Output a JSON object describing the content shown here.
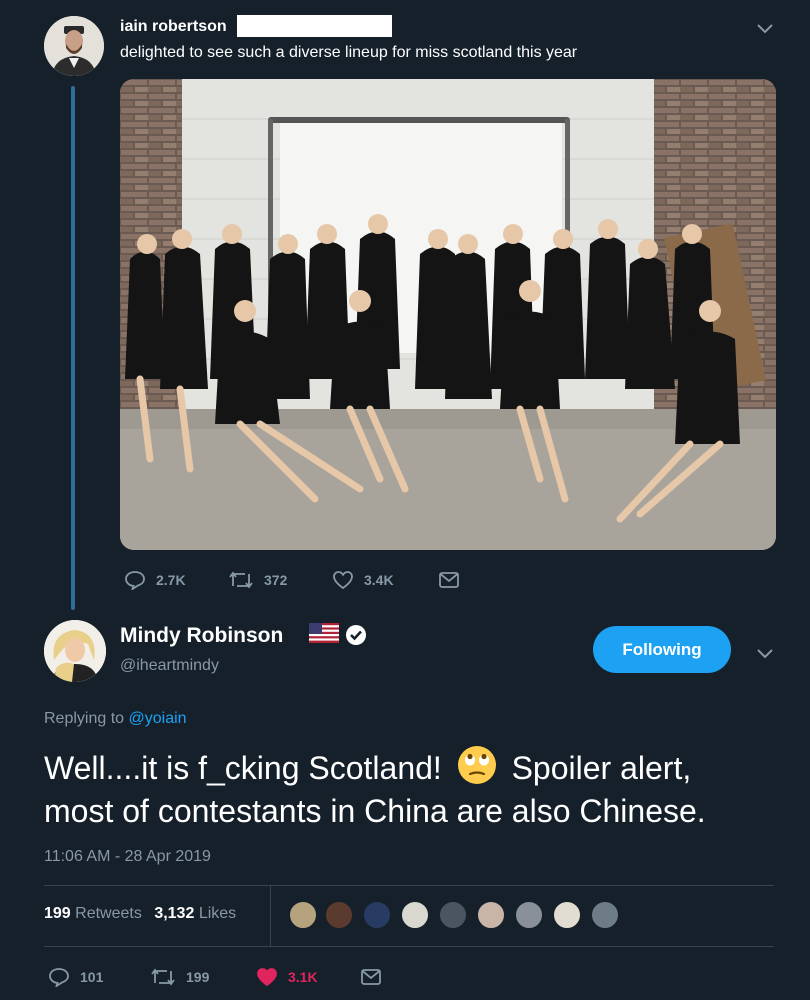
{
  "parent_tweet": {
    "author_name": "iain robertson",
    "text": "delighted to see such a diverse lineup for miss scotland this year",
    "counts": {
      "replies": "2.7K",
      "retweets": "372",
      "likes": "3.4K"
    }
  },
  "main_tweet": {
    "author_name": "Mindy Robinson",
    "handle": "@iheartmindy",
    "follow_label": "Following",
    "replying_prefix": "Replying to",
    "replying_handle": "@yoiain",
    "text_line1": "Well....it is f_cking Scotland!",
    "text_line1b": "Spoiler alert,",
    "text_line2": "most of contestants in China are also Chinese.",
    "timestamp": "11:06 AM - 28 Apr 2019",
    "stats": {
      "retweets_count": "199",
      "retweets_label": "Retweets",
      "likes_count": "3,132",
      "likes_label": "Likes"
    },
    "actions": {
      "replies": "101",
      "retweets": "199",
      "likes": "3.1K"
    }
  },
  "colors": {
    "background": "#15202b",
    "accent": "#1da1f2",
    "muted": "#8899a6",
    "like": "#e0245e"
  },
  "icons": [
    "chevron-down-icon",
    "reply-icon",
    "retweet-icon",
    "like-icon",
    "dm-icon",
    "verified-badge-icon",
    "us-flag-icon",
    "eye-roll-emoji-icon"
  ]
}
